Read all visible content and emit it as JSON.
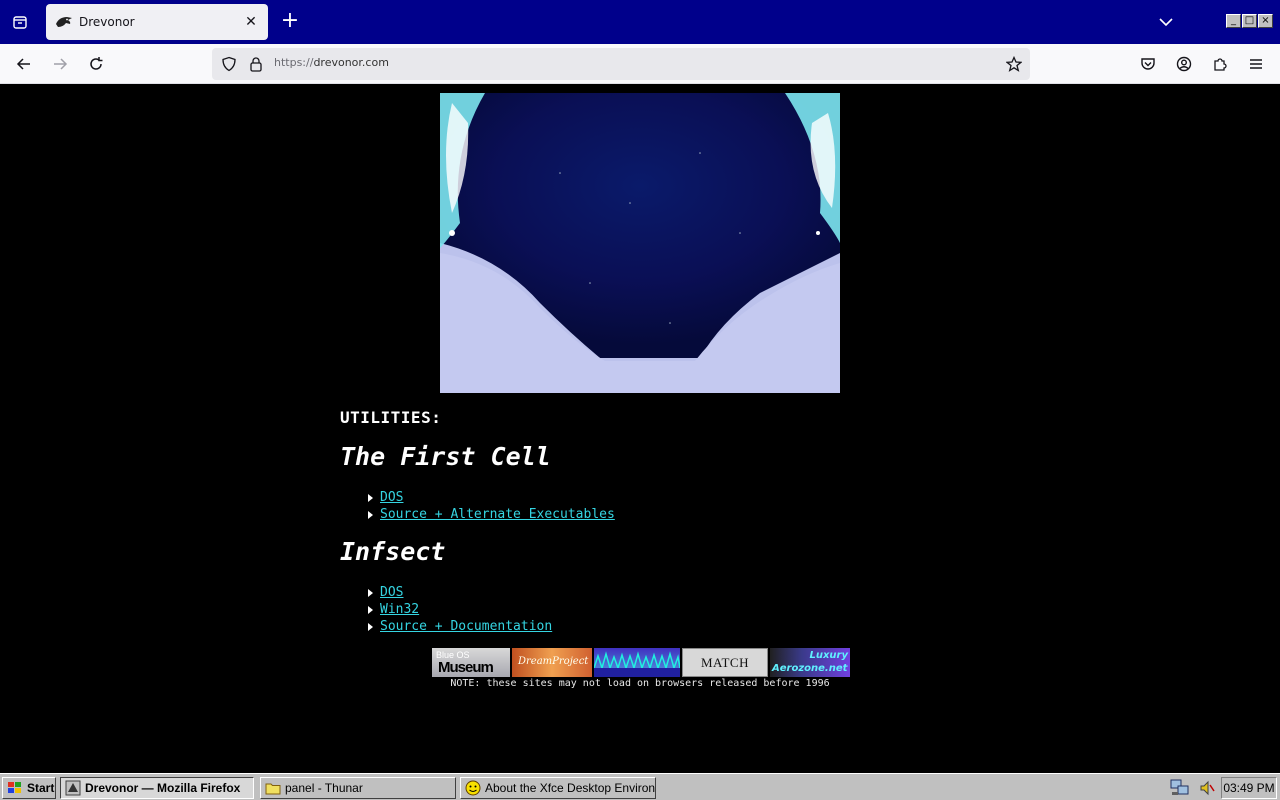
{
  "browser": {
    "tab_title": "Drevonor",
    "url_protocol": "https://",
    "url_host": "drevonor.com",
    "close_tab_glyph": "✕",
    "new_tab_glyph": "+",
    "wm_minimize": "_",
    "wm_maximize": "□",
    "wm_close": "×"
  },
  "page": {
    "section_label": "UTILITIES:",
    "items": [
      {
        "heading": "The First Cell",
        "links": [
          "DOS",
          "Source + Alternate Executables"
        ]
      },
      {
        "heading": "Infsect",
        "links": [
          "DOS",
          "Win32",
          "Source + Documentation"
        ]
      }
    ],
    "badges": [
      {
        "name": "blue-os-museum",
        "line1": "Blue OS",
        "line2": "Museum"
      },
      {
        "name": "dreamproject",
        "text": "DreamProject"
      },
      {
        "name": "waveform",
        "text": ""
      },
      {
        "name": "match",
        "text": "MATCH"
      },
      {
        "name": "aerozone",
        "line1": "Luxury",
        "line2": "Aerozone.net"
      }
    ],
    "note": "NOTE: these sites may not load on browsers released before 1996",
    "link_color": "#35d5e2"
  },
  "taskbar": {
    "start_label": "Start",
    "windows": [
      {
        "label": "Drevonor — Mozilla Firefox",
        "active": true
      },
      {
        "label": "panel - Thunar",
        "active": false
      },
      {
        "label": "About the Xfce Desktop Environ...",
        "active": false
      }
    ],
    "clock": "03:49 PM"
  }
}
